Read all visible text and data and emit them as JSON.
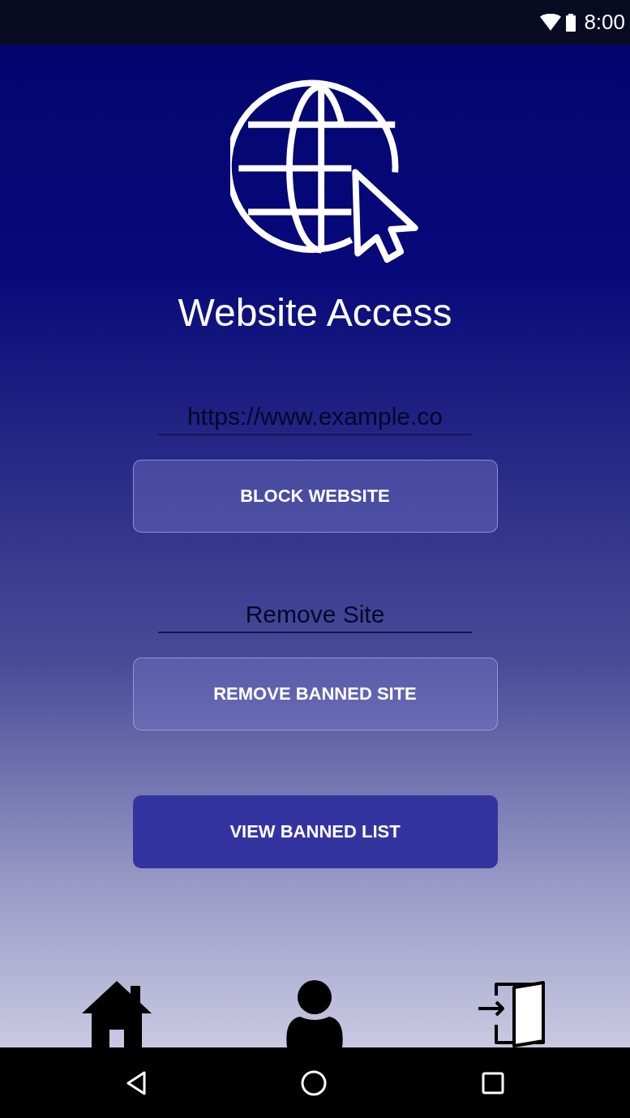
{
  "status_bar": {
    "time": "8:00"
  },
  "title": "Website Access",
  "sections": [
    {
      "field": {
        "placeholder": "https://www.example.co"
      },
      "button": {
        "label": "BLOCK WEBSITE",
        "kind": "outlined"
      }
    },
    {
      "field": {
        "placeholder": "Remove Site"
      },
      "button": {
        "label": "REMOVE BANNED SITE",
        "kind": "outlined"
      }
    },
    {
      "button": {
        "label": "VIEW BANNED LIST",
        "kind": "filled"
      }
    }
  ],
  "bottom_nav": [
    {
      "kind": "home"
    },
    {
      "kind": "profile"
    },
    {
      "kind": "login"
    }
  ]
}
